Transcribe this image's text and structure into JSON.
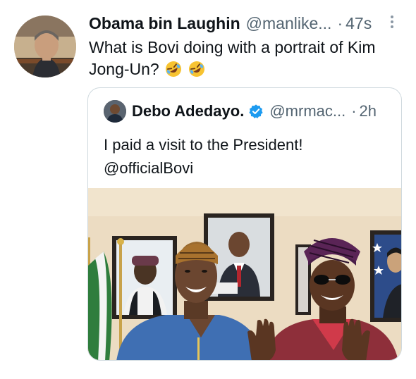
{
  "tweet": {
    "author_name": "Obama bin Laughin",
    "author_handle": "@manlike...",
    "separator": "·",
    "time": "47s",
    "text": "What is Bovi doing with a portrait of Kim Jong-Un?",
    "emojis": [
      "rolling-on-floor-laughing",
      "rolling-on-floor-laughing"
    ]
  },
  "quoted_tweet": {
    "author_name": "Debo Adedayo.",
    "author_handle": "@mrmac...",
    "separator": "·",
    "time": "2h",
    "verified": true,
    "text_line1": "I paid a visit to the President!",
    "mention": "@officialBovi"
  },
  "colors": {
    "text_primary": "#0f1419",
    "text_secondary": "#536471",
    "border": "#cfd9de",
    "verified_blue": "#1d9bf0"
  },
  "icons": {
    "more": "more-vertical-icon",
    "verified": "verified-badge-icon"
  }
}
